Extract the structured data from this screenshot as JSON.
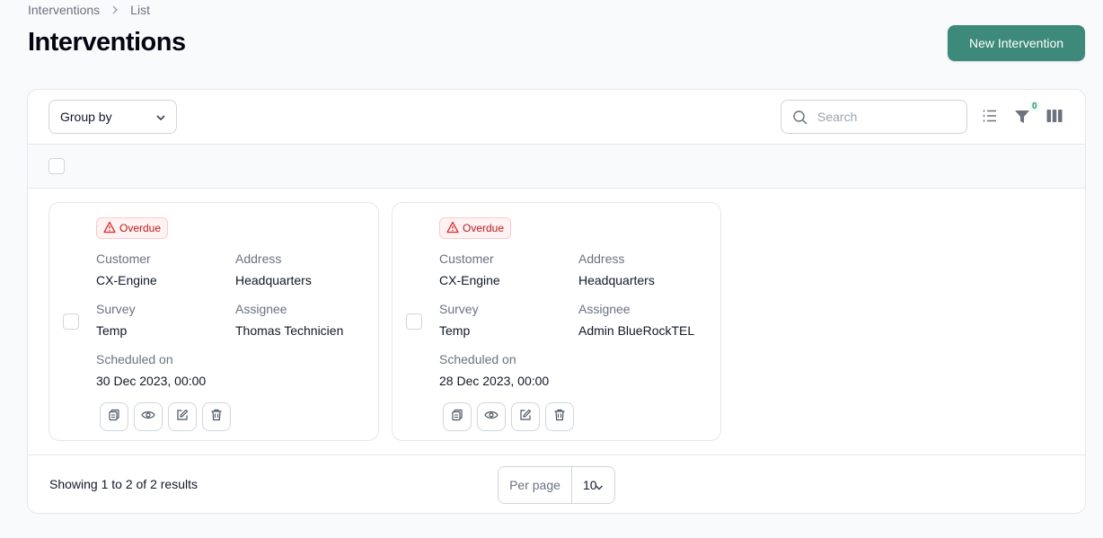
{
  "breadcrumb": {
    "items": [
      "Interventions",
      "List"
    ]
  },
  "page": {
    "title": "Interventions",
    "new_button": "New Intervention"
  },
  "toolbar": {
    "group_by": "Group by",
    "search_placeholder": "Search",
    "filter_count": "0"
  },
  "cards": [
    {
      "status": "Overdue",
      "customer_label": "Customer",
      "customer": "CX-Engine",
      "address_label": "Address",
      "address": "Headquarters",
      "survey_label": "Survey",
      "survey": "Temp",
      "assignee_label": "Assignee",
      "assignee": "Thomas Technicien",
      "scheduled_label": "Scheduled on",
      "scheduled": "30 Dec 2023, 00:00"
    },
    {
      "status": "Overdue",
      "customer_label": "Customer",
      "customer": "CX-Engine",
      "address_label": "Address",
      "address": "Headquarters",
      "survey_label": "Survey",
      "survey": "Temp",
      "assignee_label": "Assignee",
      "assignee": "Admin BlueRockTEL",
      "scheduled_label": "Scheduled on",
      "scheduled": "28 Dec 2023, 00:00"
    }
  ],
  "footer": {
    "results": "Showing 1 to 2 of 2 results",
    "per_page_label": "Per page",
    "per_page_value": "10"
  },
  "colors": {
    "primary": "#3d8a7a",
    "danger": "#b91c1c"
  }
}
